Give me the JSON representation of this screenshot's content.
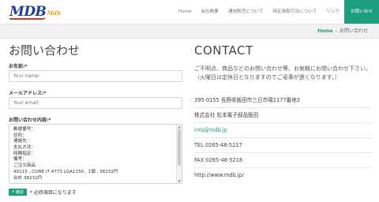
{
  "brand": {
    "logo_main": "MDB",
    "logo_sub": "Mdb"
  },
  "nav": {
    "items": [
      "Home",
      "会社概要",
      "通信販売について",
      "特定商取引法について",
      "リンク",
      "お問い合せ"
    ],
    "active_index": 5
  },
  "breadcrumb": {
    "home": "Home",
    "sep": "›",
    "current": "お問い合わせ"
  },
  "form": {
    "title": "お問い合わせ",
    "name_label": "お名前:*",
    "name_placeholder": "Your name:",
    "email_label": "メールアドレス:*",
    "email_placeholder": "Your email:",
    "message_label": "お問い合わせ内容:*",
    "message_lines": [
      "郵便番号：",
      "住所：",
      "連絡先：",
      "支払方法：",
      "時間指定：",
      "備考：",
      "ご注文商品",
      "40115 , CORE i7-4771 LGA1150 , 1個 , 38232円",
      "合計 38232円"
    ],
    "submit_label": "確認",
    "required_note": "* 必修項目になります"
  },
  "contact": {
    "title": "CONTACT",
    "intro": "ご不明点、商品などのお問い合わせ等、お気軽にお問い合わせ下さい。（火曜日は定休日となりますのでご返事が遅くなります。）",
    "address": "395-0155 長野県飯田市三日市場1177番地3",
    "company": "株式会社 松本電子部品飯田",
    "email": "info@mdb.jp",
    "tel": "TEL 0265-48-5217",
    "fax": "FAX 0265-48-5218",
    "url": "http://www.mdb.jp/"
  },
  "colors": {
    "accent": "#1f9d7f",
    "logo_blue": "#1b3f93",
    "logo_orange": "#e8a21f"
  }
}
